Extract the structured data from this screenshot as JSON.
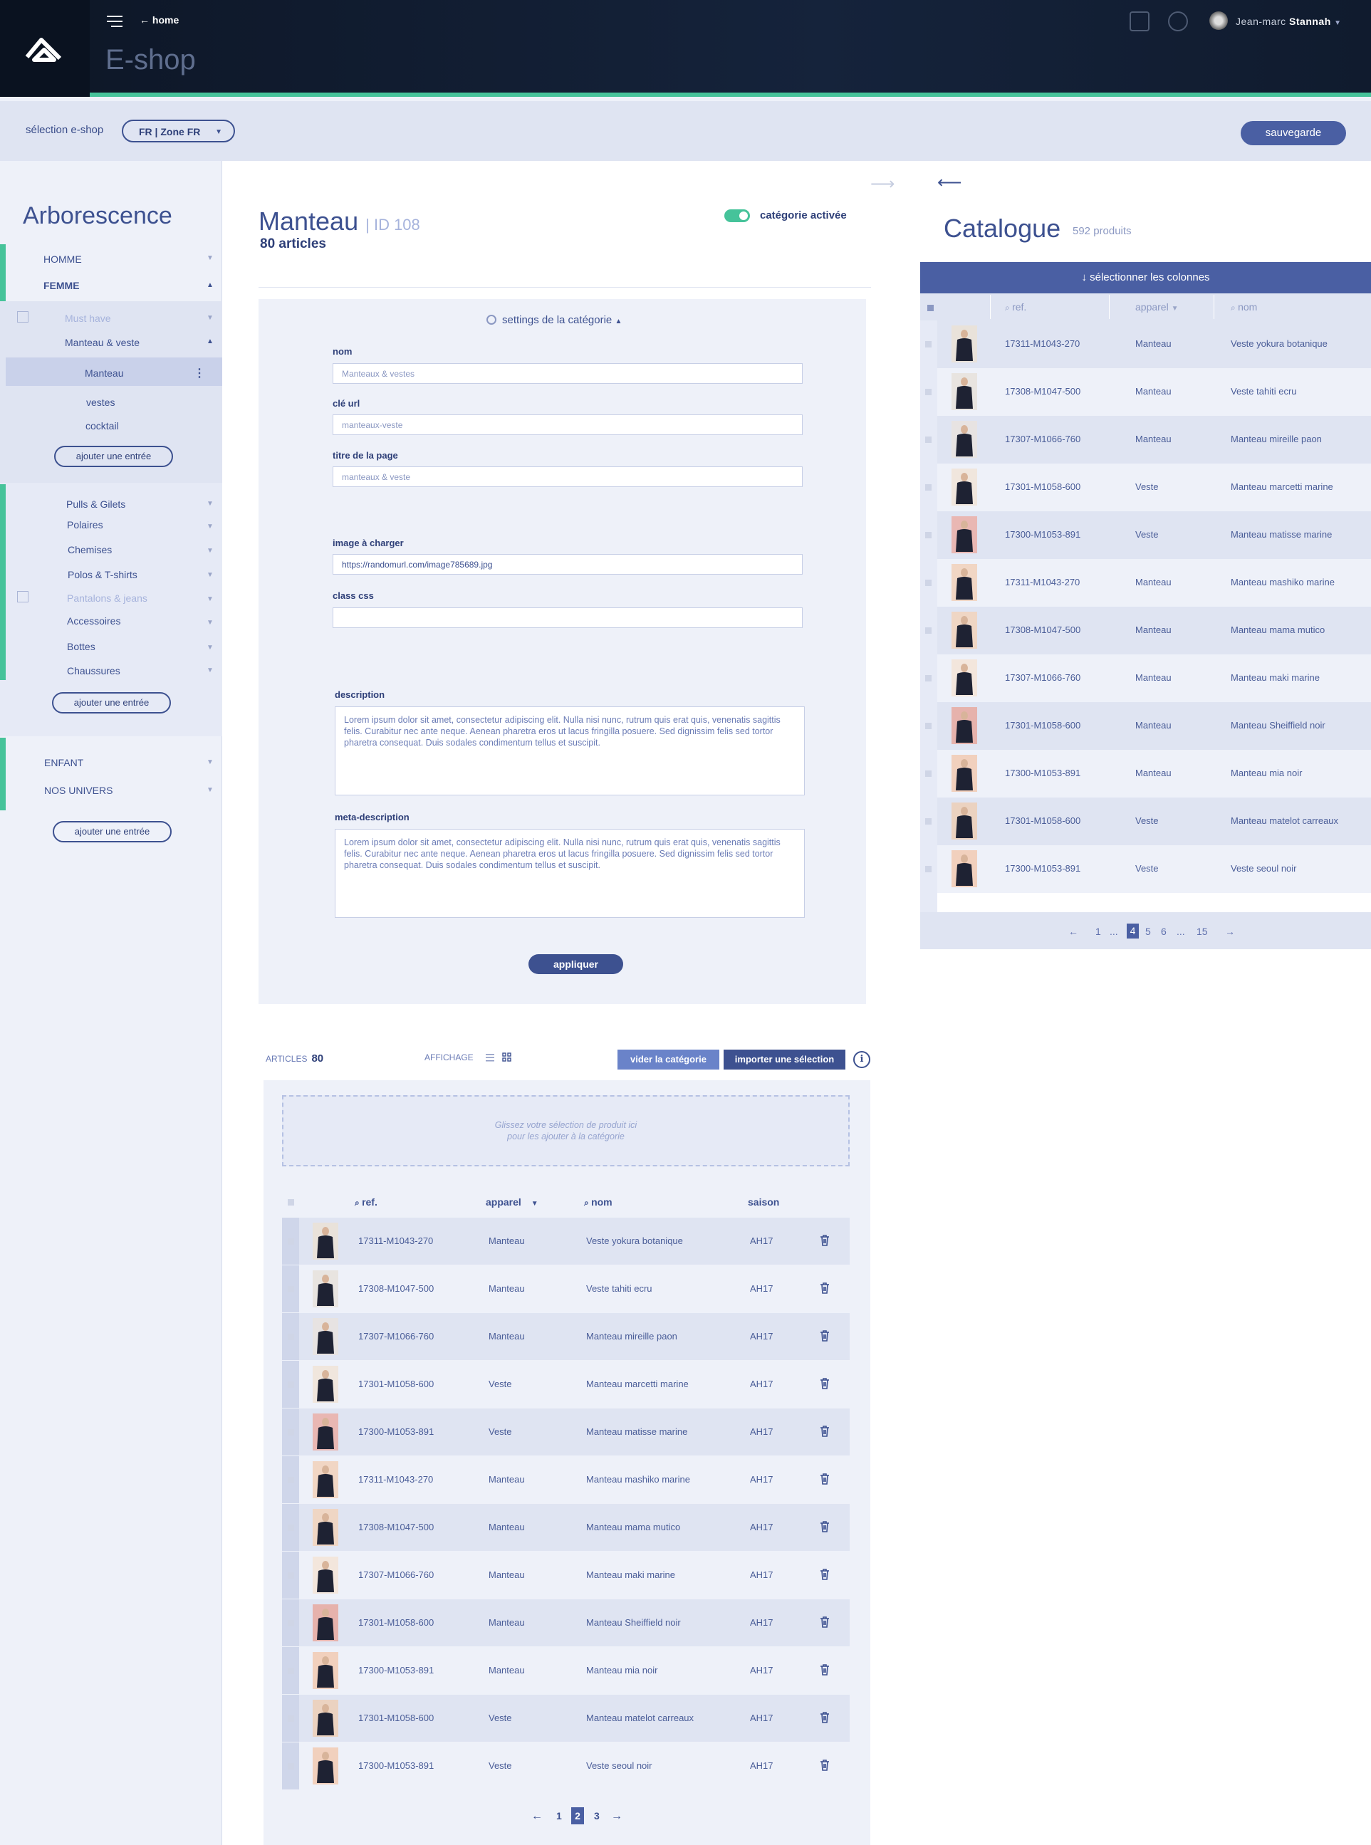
{
  "header": {
    "home_label": "home",
    "app_title": "E-shop",
    "user_first": "Jean-marc",
    "user_last": "Stannah"
  },
  "store": {
    "label": "sélection e-shop",
    "selected": "FR | Zone FR",
    "save_label": "sauvegarde"
  },
  "tree": {
    "title": "Arborescence",
    "add_label": "ajouter une entrée",
    "homme": "HOMME",
    "femme": "FEMME",
    "must_have": "Must have",
    "manteau_veste": "Manteau & veste",
    "manteau": "Manteau",
    "vestes": "vestes",
    "cocktail": "cocktail",
    "sub_items": [
      "Pulls & Gilets",
      "Polaires",
      "Chemises",
      "Polos & T-shirts",
      "Pantalons & jeans",
      "Accessoires",
      "Bottes",
      "Chaussures"
    ],
    "enfant": "ENFANT",
    "univers": "NOS UNIVERS"
  },
  "category": {
    "name": "Manteau",
    "id_label": "ID 108",
    "articles": "80 articles",
    "active_label": "catégorie activée",
    "settings_label": "settings de la catégorie",
    "fields": {
      "nom_label": "nom",
      "nom_value": "Manteaux & vestes",
      "url_label": "clé url",
      "url_value": "manteaux-veste",
      "page_title_label": "titre de la page",
      "page_title_value": "manteaux & veste",
      "image_label": "image à charger",
      "image_value": "https://randomurl.com/image785689.jpg",
      "css_label": "class css",
      "css_value": "",
      "desc_label": "description",
      "desc_value": "Lorem ipsum dolor sit amet, consectetur adipiscing elit. Nulla nisi nunc, rutrum quis erat quis, venenatis sagittis felis. Curabitur nec ante neque. Aenean pharetra eros ut lacus fringilla posuere. Sed dignissim felis sed tortor pharetra consequat. Duis sodales condimentum tellus et suscipit.",
      "meta_label": "meta-description",
      "meta_value": "Lorem ipsum dolor sit amet, consectetur adipiscing elit. Nulla nisi nunc, rutrum quis erat quis, venenatis sagittis felis. Curabitur nec ante neque. Aenean pharetra eros ut lacus fringilla posuere. Sed dignissim felis sed tortor pharetra consequat. Duis sodales condimentum tellus et suscipit."
    },
    "apply_label": "appliquer"
  },
  "articles": {
    "count_label": "ARTICLES",
    "count": "80",
    "display_label": "AFFICHAGE",
    "clear_label": "vider la catégorie",
    "import_label": "importer une sélection",
    "drop_text_1": "Glissez votre sélection  de produit ici",
    "drop_text_2": "pour les ajouter à la catégorie",
    "headers": {
      "ref": "ref.",
      "apparel": "apparel",
      "name": "nom",
      "season": "saison"
    },
    "rows": [
      {
        "ref": "17311-M1043-270",
        "apparel": "Manteau",
        "name": "Veste yokura botanique",
        "season": "AH17"
      },
      {
        "ref": "17308-M1047-500",
        "apparel": "Manteau",
        "name": "Veste tahiti ecru",
        "season": "AH17"
      },
      {
        "ref": "17307-M1066-760",
        "apparel": "Manteau",
        "name": "Manteau mireille paon",
        "season": "AH17"
      },
      {
        "ref": "17301-M1058-600",
        "apparel": "Veste",
        "name": "Manteau marcetti marine",
        "season": "AH17"
      },
      {
        "ref": "17300-M1053-891",
        "apparel": "Veste",
        "name": "Manteau matisse marine",
        "season": "AH17"
      },
      {
        "ref": "17311-M1043-270",
        "apparel": "Manteau",
        "name": "Manteau mashiko marine",
        "season": "AH17"
      },
      {
        "ref": "17308-M1047-500",
        "apparel": "Manteau",
        "name": "Manteau mama mutico",
        "season": "AH17"
      },
      {
        "ref": "17307-M1066-760",
        "apparel": "Manteau",
        "name": "Manteau maki marine",
        "season": "AH17"
      },
      {
        "ref": "17301-M1058-600",
        "apparel": "Manteau",
        "name": "Manteau Sheiffield noir",
        "season": "AH17"
      },
      {
        "ref": "17300-M1053-891",
        "apparel": "Manteau",
        "name": "Manteau mia noir",
        "season": "AH17"
      },
      {
        "ref": "17301-M1058-600",
        "apparel": "Veste",
        "name": "Manteau matelot carreaux",
        "season": "AH17"
      },
      {
        "ref": "17300-M1053-891",
        "apparel": "Veste",
        "name": "Veste seoul noir",
        "season": "AH17"
      }
    ],
    "pages": [
      "1",
      "2",
      "3"
    ],
    "current_page": "2"
  },
  "catalogue": {
    "title": "Catalogue",
    "count": "592 produits",
    "columns_label": "sélectionner les colonnes",
    "headers": {
      "ref": "ref.",
      "apparel": "apparel",
      "name": "nom"
    },
    "rows": [
      {
        "ref": "17311-M1043-270",
        "apparel": "Manteau",
        "name": "Veste yokura botanique"
      },
      {
        "ref": "17308-M1047-500",
        "apparel": "Manteau",
        "name": "Veste tahiti ecru"
      },
      {
        "ref": "17307-M1066-760",
        "apparel": "Manteau",
        "name": "Manteau mireille paon"
      },
      {
        "ref": "17301-M1058-600",
        "apparel": "Veste",
        "name": "Manteau marcetti marine"
      },
      {
        "ref": "17300-M1053-891",
        "apparel": "Veste",
        "name": "Manteau matisse marine"
      },
      {
        "ref": "17311-M1043-270",
        "apparel": "Manteau",
        "name": "Manteau mashiko marine"
      },
      {
        "ref": "17308-M1047-500",
        "apparel": "Manteau",
        "name": "Manteau mama mutico"
      },
      {
        "ref": "17307-M1066-760",
        "apparel": "Manteau",
        "name": "Manteau maki marine"
      },
      {
        "ref": "17301-M1058-600",
        "apparel": "Manteau",
        "name": "Manteau Sheiffield noir"
      },
      {
        "ref": "17300-M1053-891",
        "apparel": "Manteau",
        "name": "Manteau mia noir"
      },
      {
        "ref": "17301-M1058-600",
        "apparel": "Veste",
        "name": "Manteau matelot carreaux"
      },
      {
        "ref": "17300-M1053-891",
        "apparel": "Veste",
        "name": "Veste seoul noir"
      }
    ],
    "pages": [
      "1",
      "...",
      "4",
      "5",
      "6",
      "...",
      "15"
    ],
    "current_page": "4"
  },
  "colors": {
    "accent_green": "#46c39a",
    "primary_blue": "#4a5fa3",
    "dark_navy": "#0d1626"
  }
}
